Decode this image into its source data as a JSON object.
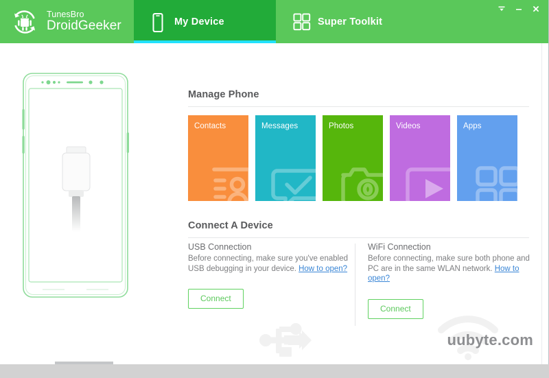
{
  "app": {
    "brand_small": "TunesBro",
    "brand_big": "DroidGeeker",
    "logo_icon": "android-refresh-icon",
    "accent_green": "#5ac85a",
    "active_tab_green": "#22ab39",
    "active_tab_underline": "#22e1ff"
  },
  "header": {
    "tabs": [
      {
        "label": "My Device",
        "icon": "phone-icon",
        "active": true
      },
      {
        "label": "Super Toolkit",
        "icon": "grid-four-icon",
        "active": false
      }
    ],
    "window_controls": [
      {
        "name": "menu-button",
        "glyph": "menu-down-icon"
      },
      {
        "name": "minimize-button",
        "glyph": "minimize-icon"
      },
      {
        "name": "close-button",
        "glyph": "close-icon"
      }
    ]
  },
  "device_preview": {
    "icon": "phone-outline-with-usb-plug",
    "outline_color": "#7fd88f",
    "plug_color": "#f2f2f2"
  },
  "manage_phone": {
    "title": "Manage Phone",
    "tiles": [
      {
        "label": "Contacts",
        "color": "#f98e3d",
        "glyph": "contact-card-icon"
      },
      {
        "label": "Messages",
        "color": "#21b7c6",
        "glyph": "message-check-icon"
      },
      {
        "label": "Photos",
        "color": "#56b60c",
        "glyph": "camera-icon"
      },
      {
        "label": "Videos",
        "color": "#bf6ce0",
        "glyph": "video-play-icon"
      },
      {
        "label": "Apps",
        "color": "#63a0ee",
        "glyph": "apps-grid-icon"
      }
    ]
  },
  "connect_device": {
    "title": "Connect A Device",
    "usb": {
      "title": "USB Connection",
      "desc_part1": "Before connecting, make sure you've enabled USB debugging in your device. ",
      "link": "How to open?",
      "button": "Connect",
      "watermark_icon": "usb-icon"
    },
    "wifi": {
      "title": "WiFi Connection",
      "desc_part1": "Before connecting, make sure both phone and PC are in the same WLAN network. ",
      "link": "How to open?",
      "button": "Connect",
      "watermark_icon": "wifi-icon"
    }
  },
  "watermark": {
    "site": "uubyte.com"
  }
}
